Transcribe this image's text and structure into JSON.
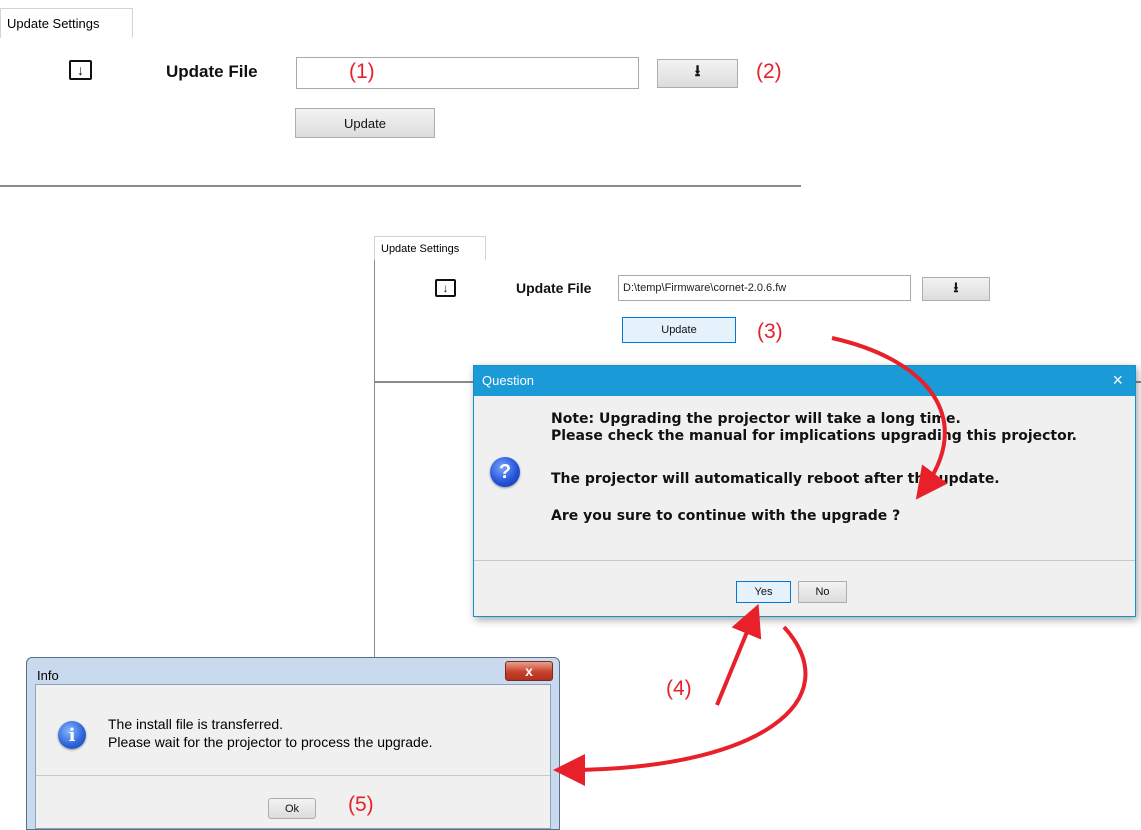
{
  "panel1": {
    "tab_label": "Update Settings",
    "update_file_label": "Update File",
    "file_value": "",
    "browse_icon": "download-icon",
    "update_label": "Update"
  },
  "panel2": {
    "tab_label": "Update Settings",
    "update_file_label": "Update File",
    "file_value": "D:\\temp\\Firmware\\cornet-2.0.6.fw",
    "browse_icon": "download-icon",
    "update_label": "Update"
  },
  "question_dialog": {
    "title": "Question",
    "close_glyph": "×",
    "icon": "question-icon",
    "lines": [
      "Note: Upgrading the projector will take a long time.",
      "Please check the manual for implications upgrading this projector.",
      "The projector will automatically reboot after the update.",
      "Are you sure to continue with the upgrade ?"
    ],
    "yes_label": "Yes",
    "no_label": "No"
  },
  "info_dialog": {
    "title": "Info",
    "close_glyph": "x",
    "icon": "info-icon",
    "lines": [
      "The install file is transferred.",
      "Please wait for the projector to process the upgrade."
    ],
    "ok_label": "Ok"
  },
  "annotations": [
    "(1)",
    "(2)",
    "(3)",
    "(4)",
    "(5)"
  ],
  "colors": {
    "annotation": "#e8202a",
    "dialog_titlebar": "#1a9ad6"
  }
}
